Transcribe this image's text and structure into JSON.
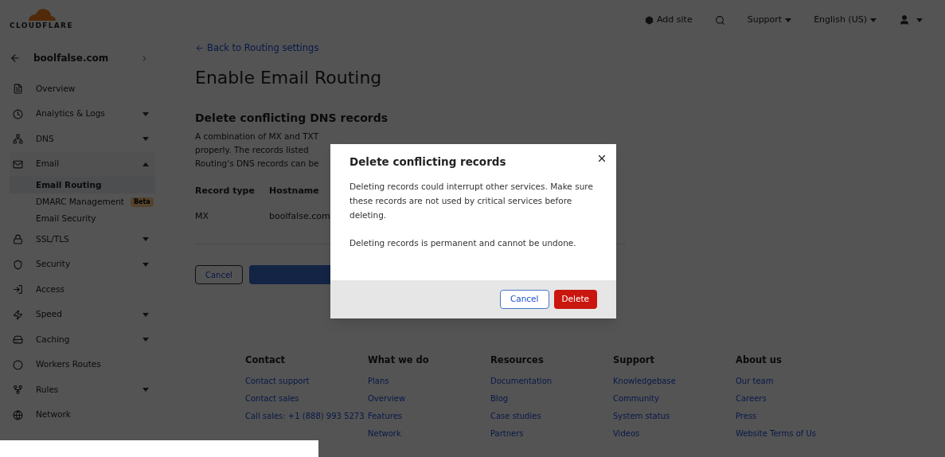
{
  "header": {
    "logo": "CLOUDFLARE",
    "add_site": "Add site",
    "support": "Support",
    "language": "English (US)"
  },
  "sidebar": {
    "domain": "boolfalse.com",
    "items": [
      {
        "label": "Overview",
        "has_menu": false
      },
      {
        "label": "Analytics & Logs",
        "has_menu": true,
        "expanded": false
      },
      {
        "label": "DNS",
        "has_menu": true,
        "expanded": false
      },
      {
        "label": "Email",
        "has_menu": true,
        "expanded": true,
        "children": [
          {
            "label": "Email Routing",
            "selected": true
          },
          {
            "label": "DMARC Management",
            "selected": false,
            "badge": "Beta"
          },
          {
            "label": "Email Security",
            "selected": false
          }
        ]
      },
      {
        "label": "SSL/TLS",
        "has_menu": true,
        "expanded": false
      },
      {
        "label": "Security",
        "has_menu": true,
        "expanded": false
      },
      {
        "label": "Access",
        "has_menu": false
      },
      {
        "label": "Speed",
        "has_menu": true,
        "expanded": false
      },
      {
        "label": "Caching",
        "has_menu": true,
        "expanded": false
      },
      {
        "label": "Workers Routes",
        "has_menu": false
      },
      {
        "label": "Rules",
        "has_menu": true,
        "expanded": false
      },
      {
        "label": "Network",
        "has_menu": false
      }
    ]
  },
  "main": {
    "back_link": "Back to Routing settings",
    "title": "Enable Email Routing",
    "section_title": "Delete conflicting DNS records",
    "description_lines": [
      "A combination of MX and TXT",
      "properly. The records listed",
      "Routing's DNS records can be"
    ],
    "table": {
      "columns": [
        "Record type",
        "Hostname"
      ],
      "rows": [
        [
          "MX",
          "boolfalse.com"
        ]
      ]
    },
    "cancel_button": "Cancel"
  },
  "dialog": {
    "title": "Delete conflicting records",
    "paragraphs": [
      "Deleting records could interrupt other services. Make sure these records are not used by critical services before deleting.",
      "Deleting records is permanent and cannot be undone."
    ],
    "cancel": "Cancel",
    "confirm": "Delete"
  },
  "footer": [
    {
      "title": "Contact",
      "links": [
        "Contact support",
        "Contact sales",
        "Call sales: +1 (888) 993 5273"
      ]
    },
    {
      "title": "What we do",
      "links": [
        "Plans",
        "Overview",
        "Features",
        "Network"
      ]
    },
    {
      "title": "Resources",
      "links": [
        "Documentation",
        "Blog",
        "Case studies",
        "Partners"
      ]
    },
    {
      "title": "Support",
      "links": [
        "Knowledgebase",
        "Community",
        "System status",
        "Videos"
      ]
    },
    {
      "title": "About us",
      "links": [
        "Our team",
        "Careers",
        "Press",
        "Website Terms of Us"
      ]
    }
  ]
}
